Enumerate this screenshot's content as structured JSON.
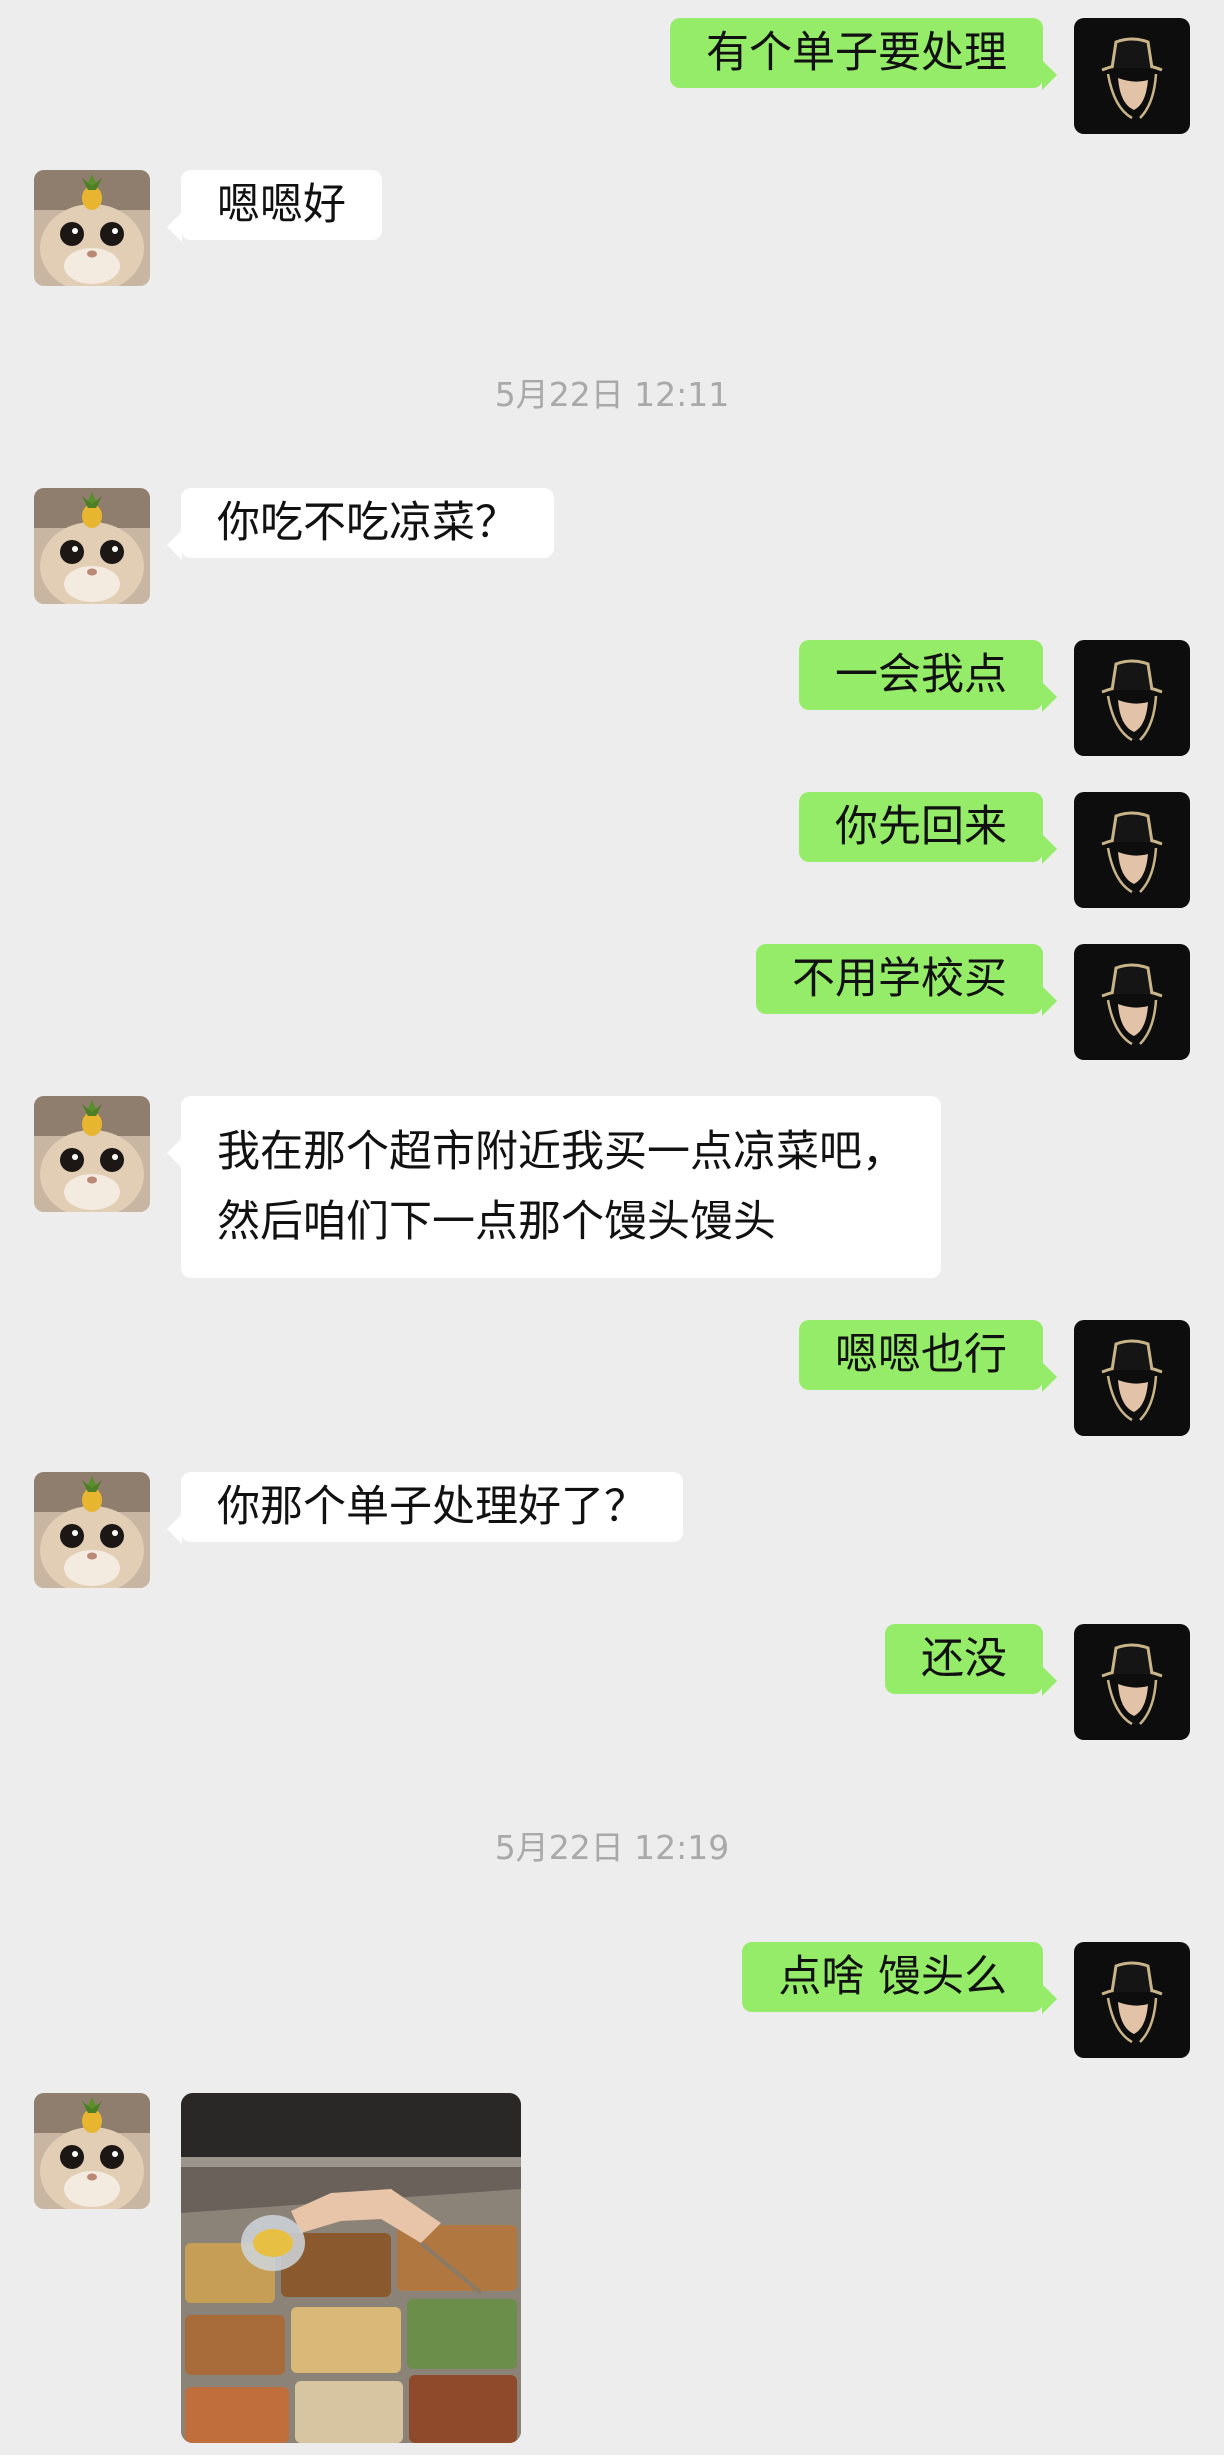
{
  "chat": {
    "messages": [
      {
        "sender": "self",
        "text": "有个单子要处理"
      },
      {
        "sender": "other",
        "text": "嗯嗯好"
      },
      {
        "type": "time",
        "text": "5月22日 12:11"
      },
      {
        "sender": "other",
        "text": "你吃不吃凉菜？"
      },
      {
        "sender": "self",
        "text": "一会我点"
      },
      {
        "sender": "self",
        "text": "你先回来"
      },
      {
        "sender": "self",
        "text": "不用学校买"
      },
      {
        "sender": "other",
        "lines": [
          "我在那个超市附近我买一点凉菜吧，",
          "然后咱们下一点那个馒头馒头"
        ]
      },
      {
        "sender": "self",
        "text": "嗯嗯也行"
      },
      {
        "sender": "other",
        "text": "你那个单子处理好了？"
      },
      {
        "sender": "self",
        "text": "还没"
      },
      {
        "type": "time",
        "text": "5月22日 12:19"
      },
      {
        "sender": "self",
        "text": "点啥 馒头么"
      },
      {
        "sender": "other",
        "type": "image",
        "icon": "deli-food-photo"
      }
    ]
  },
  "colors": {
    "background": "#ededed",
    "self_bubble": "#95ec69",
    "other_bubble": "#ffffff",
    "timestamp": "#a9a9a9"
  },
  "icons": {
    "self_avatar": "hat-masked-figure-avatar",
    "other_avatar": "cat-with-pineapple-avatar"
  }
}
